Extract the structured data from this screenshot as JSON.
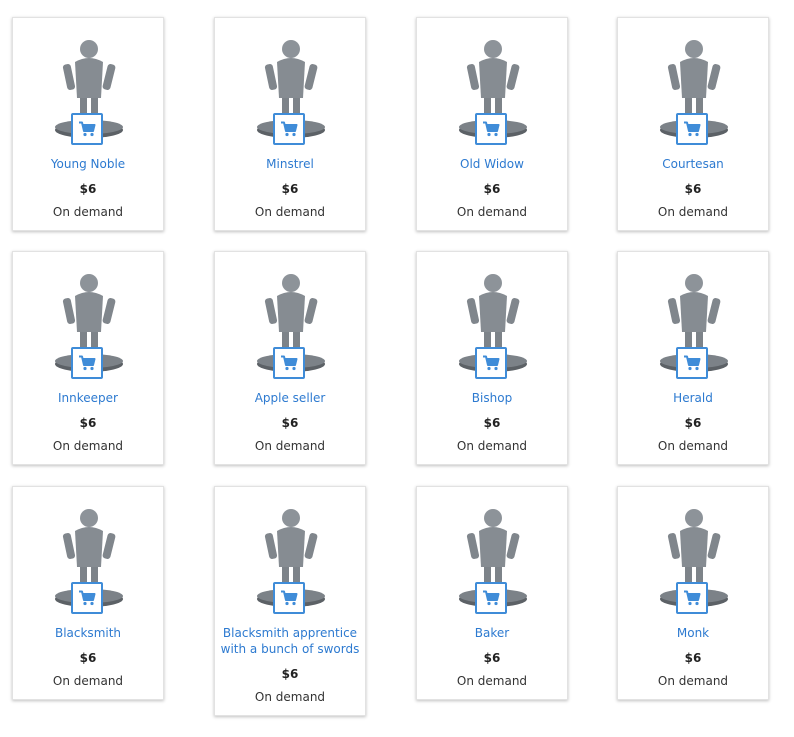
{
  "accent_color": "#3f8cd8",
  "link_color": "#2d7ad0",
  "cart_icon": "shopping-cart-icon",
  "products": [
    {
      "name": "Young Noble",
      "price": "$6",
      "availability": "On demand"
    },
    {
      "name": "Minstrel",
      "price": "$6",
      "availability": "On demand"
    },
    {
      "name": "Old Widow",
      "price": "$6",
      "availability": "On demand"
    },
    {
      "name": "Courtesan",
      "price": "$6",
      "availability": "On demand"
    },
    {
      "name": "Innkeeper",
      "price": "$6",
      "availability": "On demand"
    },
    {
      "name": "Apple seller",
      "price": "$6",
      "availability": "On demand"
    },
    {
      "name": "Bishop",
      "price": "$6",
      "availability": "On demand"
    },
    {
      "name": "Herald",
      "price": "$6",
      "availability": "On demand"
    },
    {
      "name": "Blacksmith",
      "price": "$6",
      "availability": "On demand"
    },
    {
      "name": "Blacksmith apprentice with a bunch of swords",
      "price": "$6",
      "availability": "On demand"
    },
    {
      "name": "Baker",
      "price": "$6",
      "availability": "On demand"
    },
    {
      "name": "Monk",
      "price": "$6",
      "availability": "On demand"
    }
  ]
}
